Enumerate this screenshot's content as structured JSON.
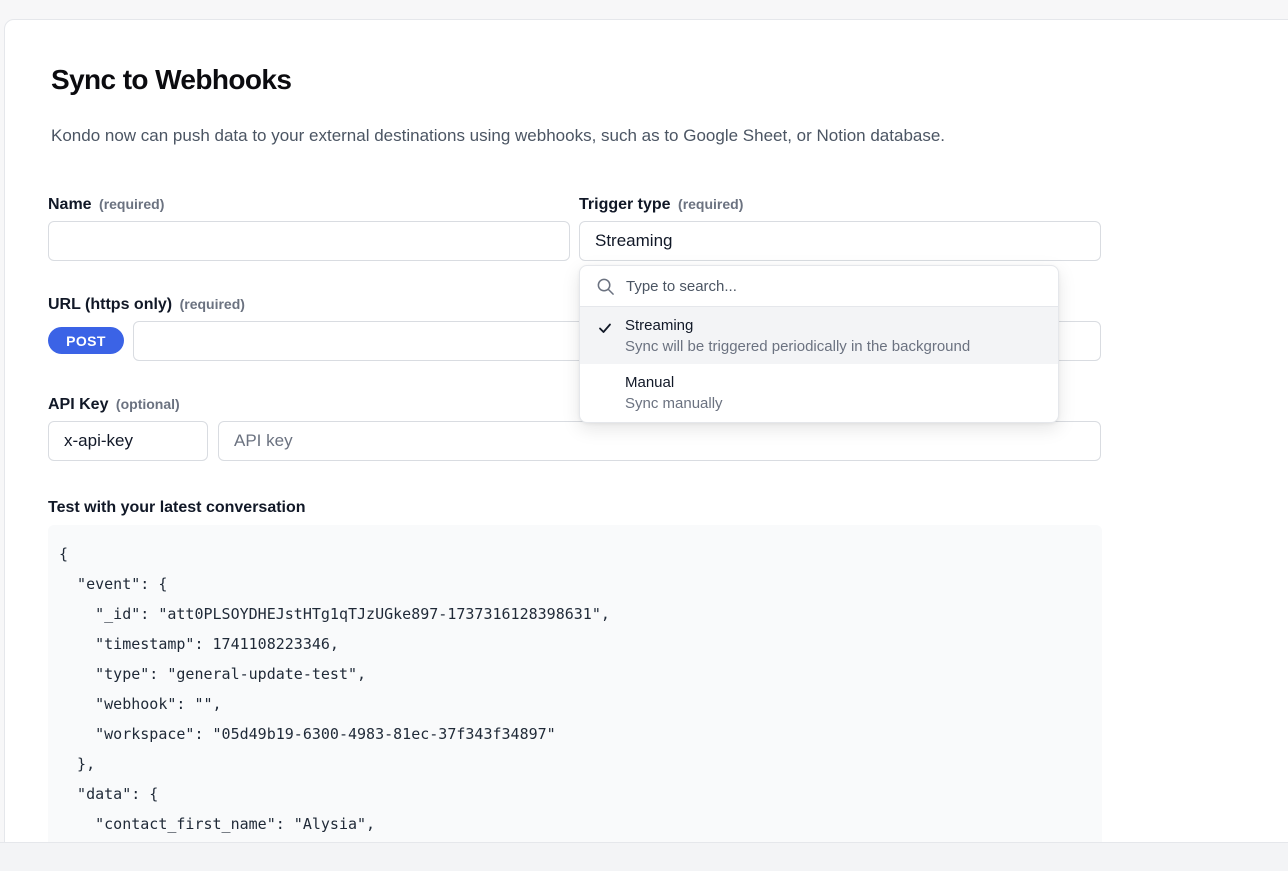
{
  "page": {
    "title": "Sync to Webhooks",
    "description": "Kondo now can push data to your external destinations using webhooks, such as to Google Sheet, or Notion database."
  },
  "form": {
    "name": {
      "label": "Name",
      "hint": "(required)",
      "value": ""
    },
    "trigger": {
      "label": "Trigger type",
      "hint": "(required)",
      "value": "Streaming"
    },
    "url": {
      "label": "URL (https only)",
      "hint": "(required)",
      "method": "POST",
      "value": ""
    },
    "api_key": {
      "label": "API Key",
      "hint": "(optional)",
      "header_value": "x-api-key",
      "key_placeholder": "API key"
    }
  },
  "dropdown": {
    "search_placeholder": "Type to search...",
    "options": [
      {
        "title": "Streaming",
        "description": "Sync will be triggered periodically in the background",
        "selected": true
      },
      {
        "title": "Manual",
        "description": "Sync manually",
        "selected": false
      }
    ]
  },
  "test": {
    "label": "Test with your latest conversation",
    "lines": [
      "{",
      "  \"event\": {",
      "    \"_id\": \"att0PLSOYDHEJstHTg1qTJzUGke897-1737316128398631\",",
      "    \"timestamp\": 1741108223346,",
      "    \"type\": \"general-update-test\",",
      "    \"webhook\": \"\",",
      "    \"workspace\": \"05d49b19-6300-4983-81ec-37f343f34897\"",
      "  },",
      "  \"data\": {",
      "    \"contact_first_name\": \"Alysia\","
    ]
  },
  "colors": {
    "accent": "#3b63e6",
    "muted_text": "#6b7280",
    "border": "#d9dce1"
  }
}
